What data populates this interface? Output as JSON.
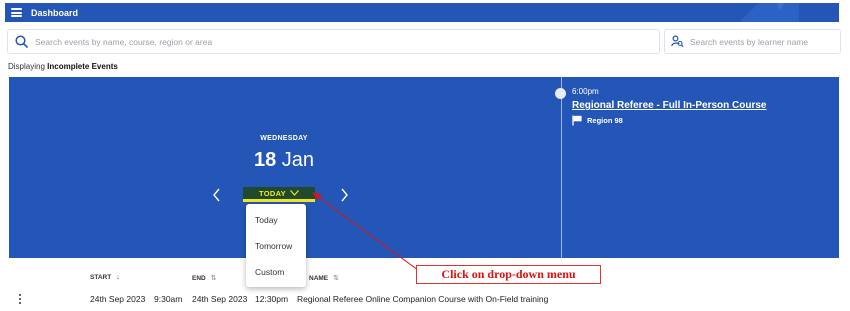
{
  "header": {
    "title": "Dashboard",
    "bg_color": "#2456b8"
  },
  "search": {
    "events_placeholder": "Search events by name, course, region or area",
    "learner_placeholder": "Search events by learner name"
  },
  "status": {
    "prefix": "Displaying",
    "filter": "Incomplete Events"
  },
  "calendar": {
    "weekday": "WEDNESDAY",
    "day": "18",
    "month": "Jan",
    "today_button": "TODAY",
    "accent_color": "#f2e51f",
    "button_color": "#1f4a2e",
    "dropdown_options": [
      "Today",
      "Tomorrow",
      "Custom"
    ]
  },
  "event": {
    "time": "6:00pm",
    "title": "Regional Referee - Full In-Person Course",
    "region": "Region 98"
  },
  "table": {
    "columns": {
      "start": "START",
      "end": "END",
      "name": "NAME"
    },
    "rows": [
      {
        "start_date": "24th Sep 2023",
        "start_time": "9:30am",
        "end_date": "24th Sep 2023",
        "end_time": "12:30pm",
        "name": "Regional Referee Online Companion Course with On-Field training"
      }
    ]
  },
  "annotation": {
    "text": "Click on drop-down menu",
    "color": "#d11"
  }
}
